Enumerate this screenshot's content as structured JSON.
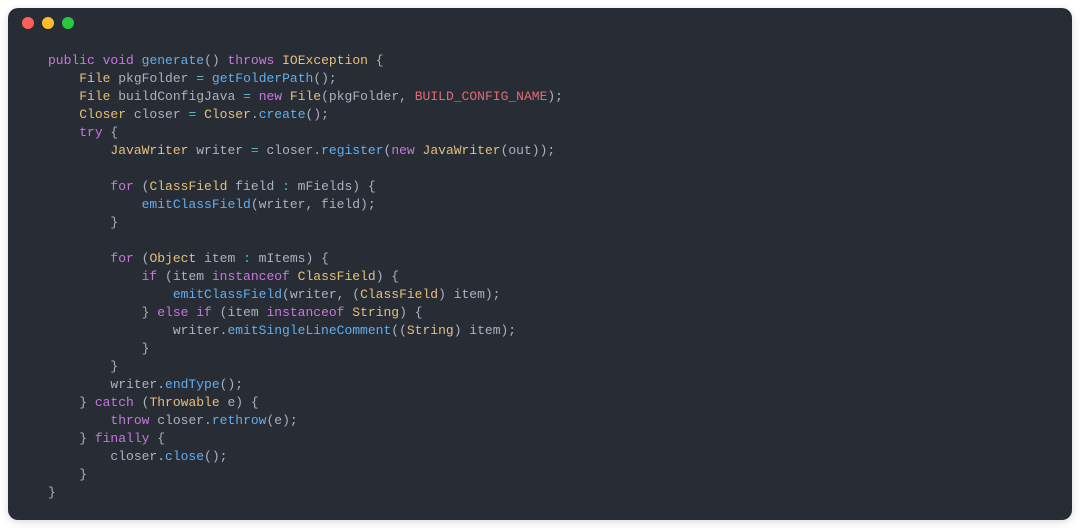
{
  "colors": {
    "bg": "#282c34",
    "fg": "#abb2bf",
    "keyword": "#c678dd",
    "type": "#e5c07b",
    "function": "#61afef",
    "variable": "#e06c75",
    "operator": "#56b6c2",
    "dot_red": "#ff5f56",
    "dot_yellow": "#ffbd2e",
    "dot_green": "#27c93f"
  },
  "code": {
    "language": "java",
    "tokens": [
      [
        [
          "kw",
          "public"
        ],
        [
          "",
          " "
        ],
        [
          "kw",
          "void"
        ],
        [
          "",
          " "
        ],
        [
          "fn",
          "generate"
        ],
        [
          "",
          "() "
        ],
        [
          "kw",
          "throws"
        ],
        [
          "",
          " "
        ],
        [
          "type",
          "IOException"
        ],
        [
          "",
          " {"
        ]
      ],
      [
        [
          "",
          "    "
        ],
        [
          "type",
          "File"
        ],
        [
          "",
          " pkgFolder "
        ],
        [
          "op",
          "="
        ],
        [
          "",
          " "
        ],
        [
          "fn",
          "getFolderPath"
        ],
        [
          "",
          "();"
        ]
      ],
      [
        [
          "",
          "    "
        ],
        [
          "type",
          "File"
        ],
        [
          "",
          " buildConfigJava "
        ],
        [
          "op",
          "="
        ],
        [
          "",
          " "
        ],
        [
          "kw",
          "new"
        ],
        [
          "",
          " "
        ],
        [
          "type",
          "File"
        ],
        [
          "",
          "(pkgFolder, "
        ],
        [
          "var",
          "BUILD_CONFIG_NAME"
        ],
        [
          "",
          ");"
        ]
      ],
      [
        [
          "",
          "    "
        ],
        [
          "type",
          "Closer"
        ],
        [
          "",
          " closer "
        ],
        [
          "op",
          "="
        ],
        [
          "",
          " "
        ],
        [
          "type",
          "Closer"
        ],
        [
          "",
          "."
        ],
        [
          "fn",
          "create"
        ],
        [
          "",
          "();"
        ]
      ],
      [
        [
          "",
          "    "
        ],
        [
          "kw",
          "try"
        ],
        [
          "",
          " {"
        ]
      ],
      [
        [
          "",
          "        "
        ],
        [
          "type",
          "JavaWriter"
        ],
        [
          "",
          " writer "
        ],
        [
          "op",
          "="
        ],
        [
          "",
          " closer."
        ],
        [
          "fn",
          "register"
        ],
        [
          "",
          "("
        ],
        [
          "kw",
          "new"
        ],
        [
          "",
          " "
        ],
        [
          "type",
          "JavaWriter"
        ],
        [
          "",
          "(out));"
        ]
      ],
      [
        [
          "",
          ""
        ]
      ],
      [
        [
          "",
          "        "
        ],
        [
          "kw",
          "for"
        ],
        [
          "",
          " ("
        ],
        [
          "type",
          "ClassField"
        ],
        [
          "",
          " field "
        ],
        [
          "op",
          ":"
        ],
        [
          "",
          " mFields) {"
        ]
      ],
      [
        [
          "",
          "            "
        ],
        [
          "fn",
          "emitClassField"
        ],
        [
          "",
          "(writer, field);"
        ]
      ],
      [
        [
          "",
          "        }"
        ]
      ],
      [
        [
          "",
          ""
        ]
      ],
      [
        [
          "",
          "        "
        ],
        [
          "kw",
          "for"
        ],
        [
          "",
          " ("
        ],
        [
          "type",
          "Object"
        ],
        [
          "",
          " item "
        ],
        [
          "op",
          ":"
        ],
        [
          "",
          " mItems) {"
        ]
      ],
      [
        [
          "",
          "            "
        ],
        [
          "kw",
          "if"
        ],
        [
          "",
          " (item "
        ],
        [
          "kw",
          "instanceof"
        ],
        [
          "",
          " "
        ],
        [
          "type",
          "ClassField"
        ],
        [
          "",
          ") {"
        ]
      ],
      [
        [
          "",
          "                "
        ],
        [
          "fn",
          "emitClassField"
        ],
        [
          "",
          "(writer, ("
        ],
        [
          "type",
          "ClassField"
        ],
        [
          "",
          ") item);"
        ]
      ],
      [
        [
          "",
          "            } "
        ],
        [
          "kw",
          "else"
        ],
        [
          "",
          " "
        ],
        [
          "kw",
          "if"
        ],
        [
          "",
          " (item "
        ],
        [
          "kw",
          "instanceof"
        ],
        [
          "",
          " "
        ],
        [
          "type",
          "String"
        ],
        [
          "",
          ") {"
        ]
      ],
      [
        [
          "",
          "                writer."
        ],
        [
          "fn",
          "emitSingleLineComment"
        ],
        [
          "",
          "(("
        ],
        [
          "type",
          "String"
        ],
        [
          "",
          ") item);"
        ]
      ],
      [
        [
          "",
          "            }"
        ]
      ],
      [
        [
          "",
          "        }"
        ]
      ],
      [
        [
          "",
          "        writer."
        ],
        [
          "fn",
          "endType"
        ],
        [
          "",
          "();"
        ]
      ],
      [
        [
          "",
          "    } "
        ],
        [
          "kw",
          "catch"
        ],
        [
          "",
          " ("
        ],
        [
          "type",
          "Throwable"
        ],
        [
          "",
          " e) {"
        ]
      ],
      [
        [
          "",
          "        "
        ],
        [
          "kw",
          "throw"
        ],
        [
          "",
          " closer."
        ],
        [
          "fn",
          "rethrow"
        ],
        [
          "",
          "(e);"
        ]
      ],
      [
        [
          "",
          "    } "
        ],
        [
          "kw",
          "finally"
        ],
        [
          "",
          " {"
        ]
      ],
      [
        [
          "",
          "        closer."
        ],
        [
          "fn",
          "close"
        ],
        [
          "",
          "();"
        ]
      ],
      [
        [
          "",
          "    }"
        ]
      ],
      [
        [
          "",
          "}"
        ]
      ]
    ]
  }
}
